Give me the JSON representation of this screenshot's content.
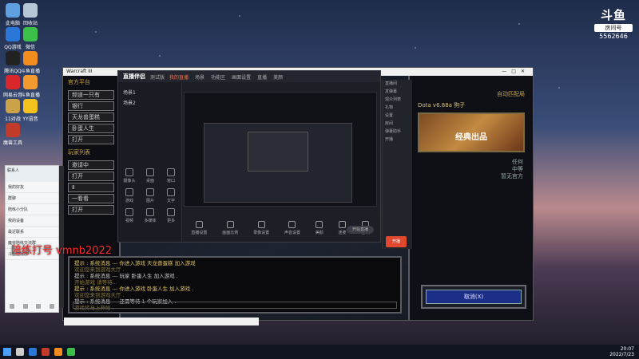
{
  "desktop": {
    "icons": [
      {
        "label": "此电脑",
        "color": "#5fa0e0"
      },
      {
        "label": "回收站",
        "color": "#b8c7d6"
      },
      {
        "label": "QQ游戏",
        "color": "#2a77d8"
      },
      {
        "label": "微信",
        "color": "#3cc04a"
      },
      {
        "label": "腾讯QQ",
        "color": "#222222"
      },
      {
        "label": "斗鱼直播",
        "color": "#f28c1f"
      },
      {
        "label": "网易云音乐",
        "color": "#d8262a"
      },
      {
        "label": "斗鱼直播伴侣",
        "color": "#f29a2f"
      },
      {
        "label": "11对战",
        "color": "#c9a24a"
      },
      {
        "label": "YY语音",
        "color": "#f2c21f"
      },
      {
        "label": "魔兽工具",
        "color": "#c23a2a"
      }
    ]
  },
  "douyu_badge": {
    "logo": "斗鱼",
    "room_label": "房间号",
    "room_number": "5562646"
  },
  "watermark": "陪练打号    vmnb2022",
  "war3": {
    "window_title": "Warcraft III",
    "left_title": "官方平台",
    "left_buttons": [
      "频道一只有",
      "银行",
      "天龙兽蛋糕",
      "卧蛋人生",
      "打开"
    ],
    "left_title2": "玩家列表",
    "left_buttons2": [
      "邀请中",
      "打开",
      "Ⅱ",
      "一看看",
      "打开"
    ],
    "map_title": "自动匹配局",
    "map_name": "Dota v6.88a 狗子",
    "map_art": "经典出品",
    "map_info": [
      "任何",
      "中等",
      "暂无官方"
    ],
    "cancel_label": "取消(X)",
    "chat_lines": [
      {
        "cls": "",
        "text": "提示 : 系统消息 --- 你进入游戏 天龙兽蛋糕 加入游戏"
      },
      {
        "cls": "hint",
        "text": "欢迎您来到游戏大厅 ."
      },
      {
        "cls": "sys",
        "text": "提示 : 系统消息 --- 玩家 卧蛋人生 加入游戏 ."
      },
      {
        "cls": "hint",
        "text": "开始游戏 请等待..."
      },
      {
        "cls": "",
        "text": "提示 : 系统消息 --- 你进入游戏 卧蛋人生 加入游戏 ."
      },
      {
        "cls": "hint",
        "text": "欢迎您来到游戏大厅 ."
      },
      {
        "cls": "sys",
        "text": "提示 : 系统消息 --- 还需等待 1 个玩家加入 ."
      },
      {
        "cls": "hint",
        "text": "游戏将马上开始 ."
      }
    ]
  },
  "obs": {
    "brand": "直播伴侣",
    "version": "测试版",
    "tabs": [
      "我的直播",
      "场景",
      "功能区",
      "画面设置",
      "直播",
      "美颜"
    ],
    "scenes": [
      "场景1",
      "场景2"
    ],
    "tools": [
      "摄像头",
      "桌面",
      "窗口",
      "游戏",
      "图片",
      "文字",
      "视频",
      "多媒体",
      "更多"
    ],
    "bottom_buttons": [
      "直播设置",
      "画面比例",
      "录像设置",
      "声音设置",
      "美颜",
      "连麦",
      "音效"
    ],
    "live_button": "开始直播"
  },
  "panel2": {
    "lines": [
      "直播间",
      "发弹幕",
      "观众列表",
      "礼物",
      "设置",
      "房间",
      "弹幕助手",
      "开播"
    ],
    "red_button": "开播"
  },
  "qq": {
    "title": "联系人",
    "items": [
      "我的好友",
      "群聊",
      "陪练小分队",
      "我的设备",
      "最近联系",
      "魔兽陪练交流群",
      "斗鱼直播群"
    ]
  },
  "taskbar": {
    "time": "20:07",
    "date": "2022/7/23"
  }
}
